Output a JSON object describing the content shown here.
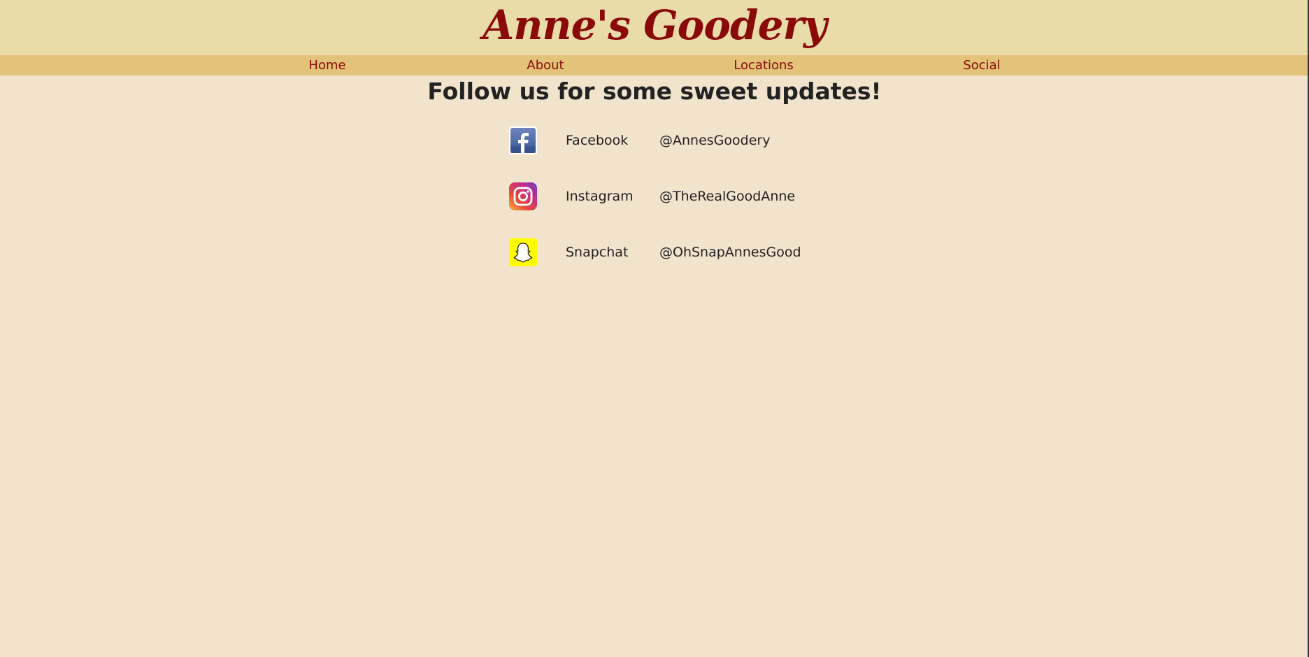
{
  "site": {
    "logo_text": "Anne's Goodery",
    "brand_color": "#8a0a0a",
    "header_color": "#e9dca8",
    "nav_color": "#e3c279",
    "background_color": "#f1e3cc"
  },
  "nav": {
    "items": [
      {
        "label": "Home"
      },
      {
        "label": "About"
      },
      {
        "label": "Locations"
      },
      {
        "label": "Social"
      }
    ]
  },
  "main": {
    "title": "Follow us for some sweet updates!",
    "socials": [
      {
        "icon": "facebook-icon",
        "name": "Facebook",
        "handle": "@AnnesGoodery"
      },
      {
        "icon": "instagram-icon",
        "name": "Instagram",
        "handle": "@TheRealGoodAnne"
      },
      {
        "icon": "snapchat-icon",
        "name": "Snapchat",
        "handle": "@OhSnapAnnesGood"
      }
    ]
  }
}
